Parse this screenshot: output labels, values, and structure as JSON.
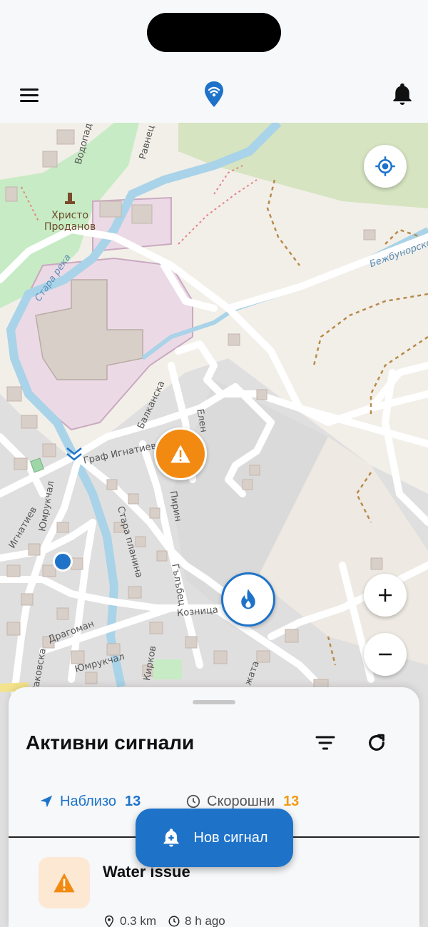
{
  "map": {
    "labels": {
      "church": "Христо\nПроданов",
      "river1": "Стара река",
      "river2": "Бежбунорско",
      "street_graf": "Граф Игнатиев",
      "street_balkanska": "Балканска",
      "street_pirin": "Пирин",
      "street_yumruk": "Юмрукчал",
      "street_stara_planina": "Стара планина",
      "street_galabets": "Гълъбец",
      "street_koznitsa": "Козница",
      "street_dragoman": "Драгоман",
      "street_vodopad": "Водопад",
      "street_ravnets": "Равнец",
      "street_elen": "Елен",
      "street_ignatiev": "Игнатиев",
      "street_rakovska": "Раковска",
      "street_kirkov": "Кирков",
      "street_hajata": "жата"
    }
  },
  "sheet": {
    "title": "Активни сигнали",
    "tabs": [
      {
        "label": "Наблизо",
        "count": "13"
      },
      {
        "label": "Скорошни",
        "count": "13"
      }
    ],
    "alerts": [
      {
        "title": "Water issue",
        "distance": "0.3 km",
        "time": "8 h ago"
      }
    ]
  },
  "fab": {
    "label": "Нов сигнал"
  },
  "colors": {
    "primary": "#1e73c9",
    "warning": "#f28a12"
  }
}
